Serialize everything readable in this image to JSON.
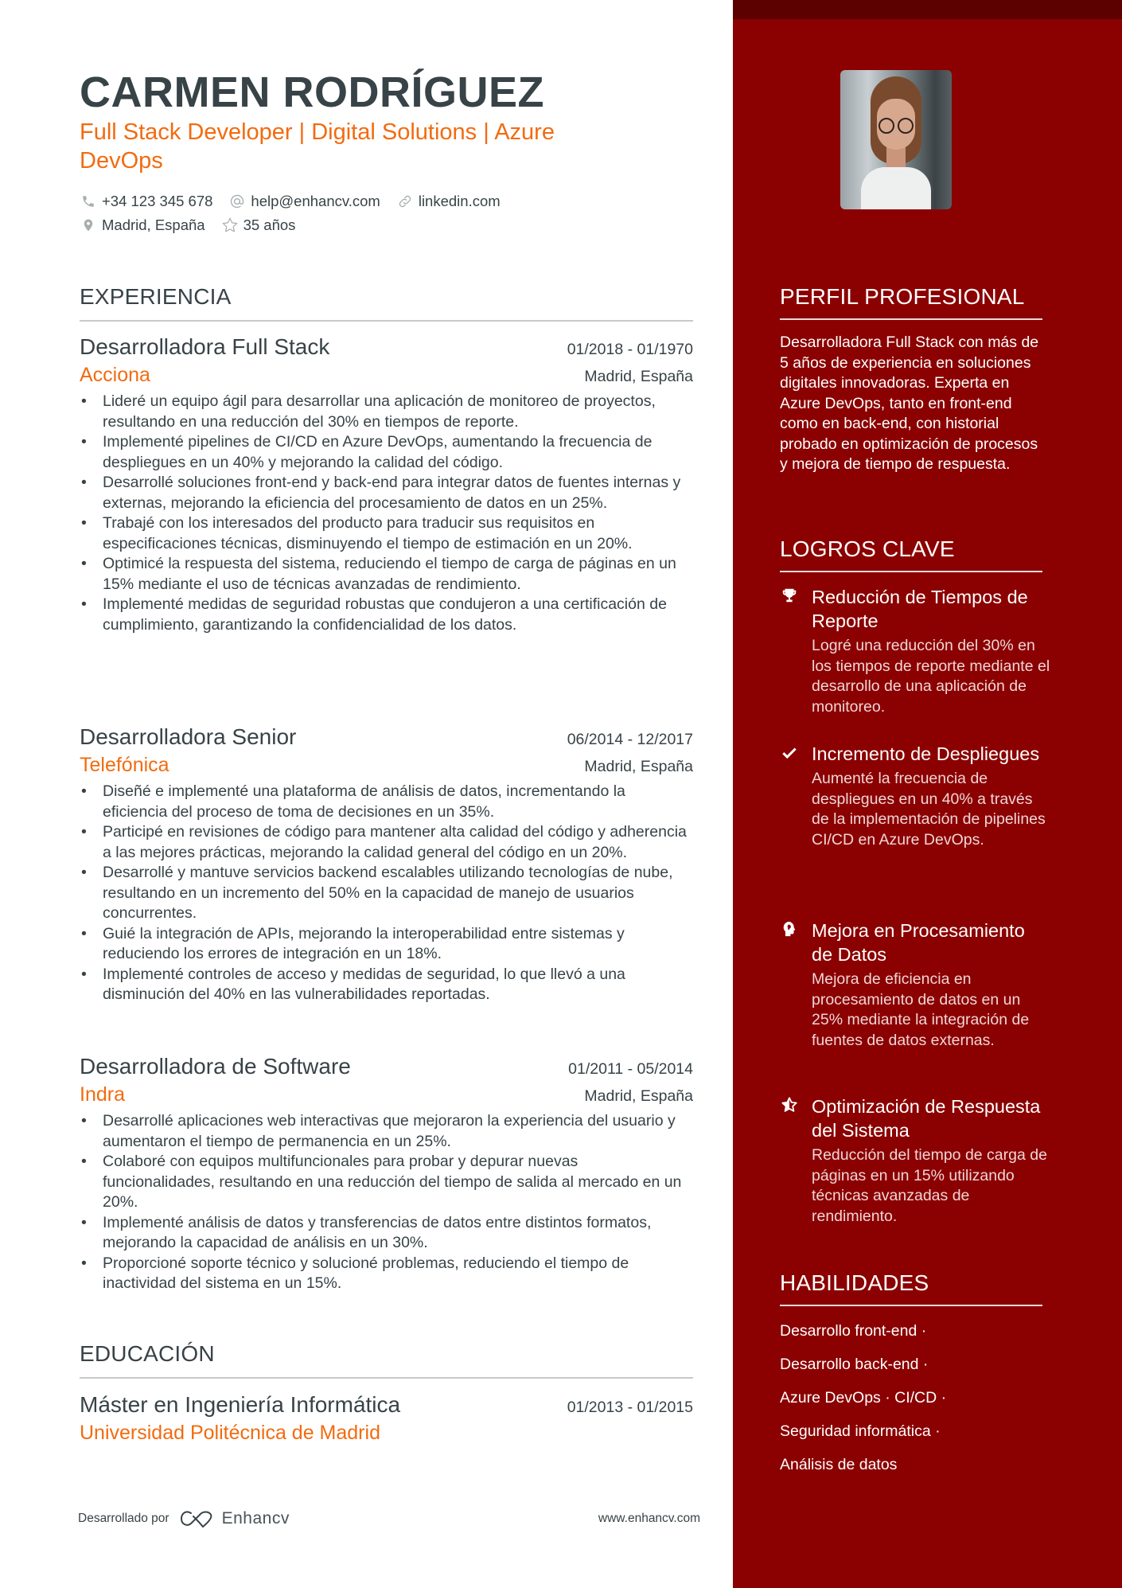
{
  "header": {
    "name": "CARMEN RODRÍGUEZ",
    "tagline": "Full Stack Developer | Digital Solutions | Azure DevOps",
    "contacts": [
      {
        "icon": "phone-icon",
        "text": "+34 123 345 678"
      },
      {
        "icon": "at-icon",
        "text": "help@enhancv.com"
      },
      {
        "icon": "link-icon",
        "text": "linkedin.com"
      },
      {
        "icon": "location-pin-icon",
        "text": "Madrid, España"
      },
      {
        "icon": "star-icon",
        "text": "35 años"
      }
    ]
  },
  "experience": {
    "heading": "EXPERIENCIA",
    "jobs": [
      {
        "title": "Desarrolladora Full Stack",
        "dates": "01/2018 - 01/1970",
        "company": "Acciona",
        "location": "Madrid, España",
        "bullets": [
          "Lideré un equipo ágil para desarrollar una aplicación de monitoreo de proyectos, resultando en una reducción del 30% en tiempos de reporte.",
          "Implementé pipelines de CI/CD en Azure DevOps, aumentando la frecuencia de despliegues en un 40% y mejorando la calidad del código.",
          "Desarrollé soluciones front-end y back-end para integrar datos de fuentes internas y externas, mejorando la eficiencia del procesamiento de datos en un 25%.",
          "Trabajé con los interesados del producto para traducir sus requisitos en especificaciones técnicas, disminuyendo el tiempo de estimación en un 20%.",
          "Optimicé la respuesta del sistema, reduciendo el tiempo de carga de páginas en un 15% mediante el uso de técnicas avanzadas de rendimiento.",
          "Implementé medidas de seguridad robustas que condujeron a una certificación de cumplimiento, garantizando la confidencialidad de los datos."
        ]
      },
      {
        "title": "Desarrolladora Senior",
        "dates": "06/2014 - 12/2017",
        "company": "Telefónica",
        "location": "Madrid, España",
        "bullets": [
          "Diseñé e implementé una plataforma de análisis de datos, incrementando la eficiencia del proceso de toma de decisiones en un 35%.",
          "Participé en revisiones de código para mantener alta calidad del código y adherencia a las mejores prácticas, mejorando la calidad general del código en un 20%.",
          "Desarrollé y mantuve servicios backend escalables utilizando tecnologías de nube, resultando en un incremento del 50% en la capacidad de manejo de usuarios concurrentes.",
          "Guié la integración de APIs, mejorando la interoperabilidad entre sistemas y reduciendo los errores de integración en un 18%.",
          "Implementé controles de acceso y medidas de seguridad, lo que llevó a una disminución del 40% en las vulnerabilidades reportadas."
        ]
      },
      {
        "title": "Desarrolladora de Software",
        "dates": "01/2011 - 05/2014",
        "company": "Indra",
        "location": "Madrid, España",
        "bullets": [
          "Desarrollé aplicaciones web interactivas que mejoraron la experiencia del usuario y aumentaron el tiempo de permanencia en un 25%.",
          "Colaboré con equipos multifuncionales para probar y depurar nuevas funcionalidades, resultando en una reducción del tiempo de salida al mercado en un 20%.",
          "Implementé análisis de datos y transferencias de datos entre distintos formatos, mejorando la capacidad de análisis en un 30%.",
          "Proporcioné soporte técnico y solucioné problemas, reduciendo el tiempo de inactividad del sistema en un 15%."
        ]
      }
    ]
  },
  "education": {
    "heading": "EDUCACIÓN",
    "items": [
      {
        "degree": "Máster en Ingeniería Informática",
        "dates": "01/2013 - 01/2015",
        "school": "Universidad Politécnica de Madrid"
      }
    ]
  },
  "sidebar": {
    "photo_alt": "Profile photo",
    "profile": {
      "heading": "PERFIL PROFESIONAL",
      "text": "Desarrolladora Full Stack con más de 5 años de experiencia en soluciones digitales innovadoras. Experta en Azure DevOps, tanto en front-end como en back-end, con historial probado en optimización de procesos y mejora de tiempo de respuesta."
    },
    "achievements": {
      "heading": "LOGROS CLAVE",
      "items": [
        {
          "icon": "trophy-icon",
          "title": "Reducción de Tiempos de Reporte",
          "desc": "Logré una reducción del 30% en los tiempos de reporte mediante el desarrollo de una aplicación de monitoreo."
        },
        {
          "icon": "checkmark-icon",
          "title": "Incremento de Despliegues",
          "desc": "Aumenté la frecuencia de despliegues en un 40% a través de la implementación de pipelines CI/CD en Azure DevOps."
        },
        {
          "icon": "brain-head-icon",
          "title": "Mejora en Procesamiento de Datos",
          "desc": "Mejora de eficiencia en procesamiento de datos en un 25% mediante la integración de fuentes de datos externas."
        },
        {
          "icon": "half-star-icon",
          "title": "Optimización de Respuesta del Sistema",
          "desc": "Reducción del tiempo de carga de páginas en un 15% utilizando técnicas avanzadas de rendimiento."
        }
      ]
    },
    "skills": {
      "heading": "HABILIDADES",
      "lines": [
        "Desarrollo front-end ·",
        "Desarrollo back-end ·",
        "Azure DevOps · CI/CD ·",
        "Seguridad informática ·",
        "Análisis de datos"
      ]
    }
  },
  "footer": {
    "powered_by": "Desarrollado por",
    "brand": "Enhancv",
    "website": "www.enhancv.com"
  },
  "colors": {
    "accent": "#f26b0f",
    "sidebar_bg": "#8b0000",
    "sidebar_band": "#5c0000",
    "text": "#384347"
  }
}
